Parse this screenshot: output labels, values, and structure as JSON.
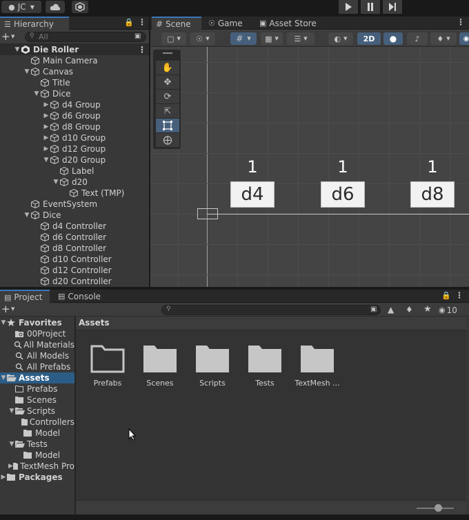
{
  "toolbar": {
    "account": "JC",
    "play_icon": "play-icon",
    "pause_icon": "pause-icon",
    "step_icon": "step-icon"
  },
  "hierarchy": {
    "tab": "Hierarchy",
    "search_placeholder": "All",
    "items": [
      {
        "label": "Die Roller",
        "depth": 0,
        "arrow": "down",
        "scene": true
      },
      {
        "label": "Main Camera",
        "depth": 1,
        "arrow": ""
      },
      {
        "label": "Canvas",
        "depth": 1,
        "arrow": "down"
      },
      {
        "label": "Title",
        "depth": 2,
        "arrow": ""
      },
      {
        "label": "Dice",
        "depth": 2,
        "arrow": "down"
      },
      {
        "label": "d4 Group",
        "depth": 3,
        "arrow": "right"
      },
      {
        "label": "d6 Group",
        "depth": 3,
        "arrow": "right"
      },
      {
        "label": "d8 Group",
        "depth": 3,
        "arrow": "right"
      },
      {
        "label": "d10 Group",
        "depth": 3,
        "arrow": "right"
      },
      {
        "label": "d12 Group",
        "depth": 3,
        "arrow": "right"
      },
      {
        "label": "d20 Group",
        "depth": 3,
        "arrow": "down"
      },
      {
        "label": "Label",
        "depth": 4,
        "arrow": ""
      },
      {
        "label": "d20",
        "depth": 4,
        "arrow": "down"
      },
      {
        "label": "Text (TMP)",
        "depth": 5,
        "arrow": ""
      },
      {
        "label": "EventSystem",
        "depth": 1,
        "arrow": ""
      },
      {
        "label": "Dice",
        "depth": 1,
        "arrow": "down"
      },
      {
        "label": "d4 Controller",
        "depth": 2,
        "arrow": ""
      },
      {
        "label": "d6 Controller",
        "depth": 2,
        "arrow": ""
      },
      {
        "label": "d8 Controller",
        "depth": 2,
        "arrow": ""
      },
      {
        "label": "d10 Controller",
        "depth": 2,
        "arrow": ""
      },
      {
        "label": "d12 Controller",
        "depth": 2,
        "arrow": ""
      },
      {
        "label": "d20 Controller",
        "depth": 2,
        "arrow": ""
      }
    ]
  },
  "scene_view": {
    "tabs": [
      "Scene",
      "Game",
      "Asset Store"
    ],
    "toggle_2d": "2D",
    "dice": [
      {
        "number": "1",
        "label": "d4"
      },
      {
        "number": "1",
        "label": "d6"
      },
      {
        "number": "1",
        "label": "d8"
      }
    ]
  },
  "project": {
    "tabs": [
      "Project",
      "Console"
    ],
    "hidden_count": "10",
    "breadcrumb": "Assets",
    "tree": [
      {
        "label": "Favorites",
        "depth": 0,
        "arrow": "down",
        "icon": "star",
        "bold": true
      },
      {
        "label": "00Project",
        "depth": 1,
        "arrow": "",
        "icon": "folder-search"
      },
      {
        "label": "All Materials",
        "depth": 1,
        "arrow": "",
        "icon": "search"
      },
      {
        "label": "All Models",
        "depth": 1,
        "arrow": "",
        "icon": "search"
      },
      {
        "label": "All Prefabs",
        "depth": 1,
        "arrow": "",
        "icon": "search"
      },
      {
        "label": "Assets",
        "depth": 0,
        "arrow": "down",
        "icon": "folder-open",
        "bold": true,
        "selected": true
      },
      {
        "label": "Prefabs",
        "depth": 1,
        "arrow": "",
        "icon": "folder-empty"
      },
      {
        "label": "Scenes",
        "depth": 1,
        "arrow": "",
        "icon": "folder"
      },
      {
        "label": "Scripts",
        "depth": 1,
        "arrow": "down",
        "icon": "folder-open"
      },
      {
        "label": "Controllers",
        "depth": 2,
        "arrow": "",
        "icon": "folder"
      },
      {
        "label": "Model",
        "depth": 2,
        "arrow": "",
        "icon": "folder"
      },
      {
        "label": "Tests",
        "depth": 1,
        "arrow": "down",
        "icon": "folder-open"
      },
      {
        "label": "Model",
        "depth": 2,
        "arrow": "",
        "icon": "folder"
      },
      {
        "label": "TextMesh Pro",
        "depth": 1,
        "arrow": "right",
        "icon": "folder"
      },
      {
        "label": "Packages",
        "depth": 0,
        "arrow": "right",
        "icon": "folder",
        "bold": true
      }
    ],
    "assets": [
      {
        "label": "Prefabs",
        "icon": "folder-empty"
      },
      {
        "label": "Scenes",
        "icon": "folder"
      },
      {
        "label": "Scripts",
        "icon": "folder"
      },
      {
        "label": "Tests",
        "icon": "folder"
      },
      {
        "label": "TextMesh ...",
        "icon": "folder"
      }
    ]
  }
}
